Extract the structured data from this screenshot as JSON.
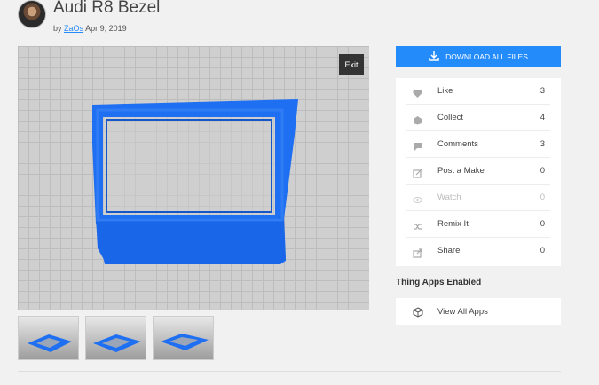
{
  "thing": {
    "title": "Audi R8 Bezel",
    "by_prefix": "by",
    "author": "ZaOs",
    "date": "Apr 9, 2019"
  },
  "viewer": {
    "exit_label": "Exit",
    "background_color": "#cfcfcf",
    "model_color": "#1f6ff2"
  },
  "thumbnails": [
    {
      "name": "thumbnail-1"
    },
    {
      "name": "thumbnail-2"
    },
    {
      "name": "thumbnail-3"
    }
  ],
  "download": {
    "label": "DOWNLOAD ALL FILES",
    "icon": "download-icon",
    "color": "#248bfb"
  },
  "stats": [
    {
      "label": "Like",
      "count": "3",
      "icon": "heart-icon"
    },
    {
      "label": "Collect",
      "count": "4",
      "icon": "collect-icon"
    },
    {
      "label": "Comments",
      "count": "3",
      "icon": "comment-icon"
    },
    {
      "label": "Post a Make",
      "count": "0",
      "icon": "make-icon"
    },
    {
      "label": "Watch",
      "count": "0",
      "icon": "eye-icon",
      "disabled": true
    },
    {
      "label": "Remix It",
      "count": "0",
      "icon": "shuffle-icon"
    },
    {
      "label": "Share",
      "count": "0",
      "icon": "share-icon"
    }
  ],
  "apps": {
    "heading": "Thing Apps Enabled",
    "view_all_label": "View All Apps",
    "icon": "cube-icon"
  }
}
